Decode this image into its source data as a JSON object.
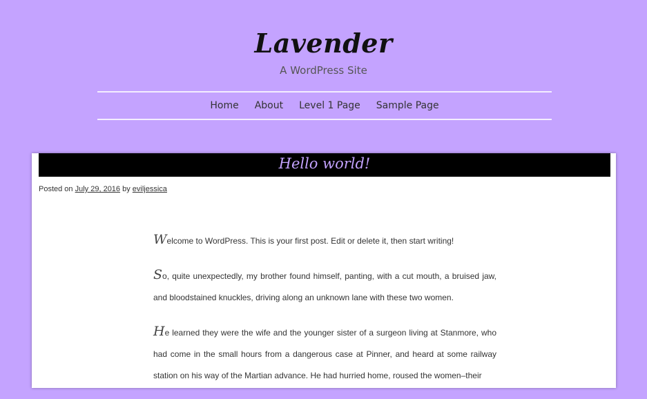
{
  "site": {
    "title": "Lavender",
    "tagline": "A WordPress Site"
  },
  "nav": {
    "items": [
      {
        "label": "Home"
      },
      {
        "label": "About"
      },
      {
        "label": "Level 1 Page"
      },
      {
        "label": "Sample Page"
      }
    ]
  },
  "post": {
    "title": "Hello world!",
    "meta": {
      "posted_on_label": "Posted on",
      "date": "July 29, 2016",
      "by_label": "by",
      "author": "eviljessica"
    },
    "paragraphs": [
      {
        "initial": "W",
        "text": "elcome to WordPress. This is your first post. Edit or delete it, then start writing!"
      },
      {
        "initial": "S",
        "text": "o, quite unexpectedly, my brother found himself, panting, with a cut mouth, a bruised jaw, and bloodstained knuckles, driving along an unknown lane with these two women."
      },
      {
        "initial": "H",
        "text": "e learned they were the wife and the younger sister of a surgeon living at Stanmore, who had come in the small hours from a dangerous case at Pinner, and heard at some railway station on his way of the Martian advance. He had hurried home, roused the women–their"
      }
    ]
  },
  "colors": {
    "background": "#c4a3ff",
    "title_bar": "#000000",
    "title_text": "#c4a3ff"
  }
}
